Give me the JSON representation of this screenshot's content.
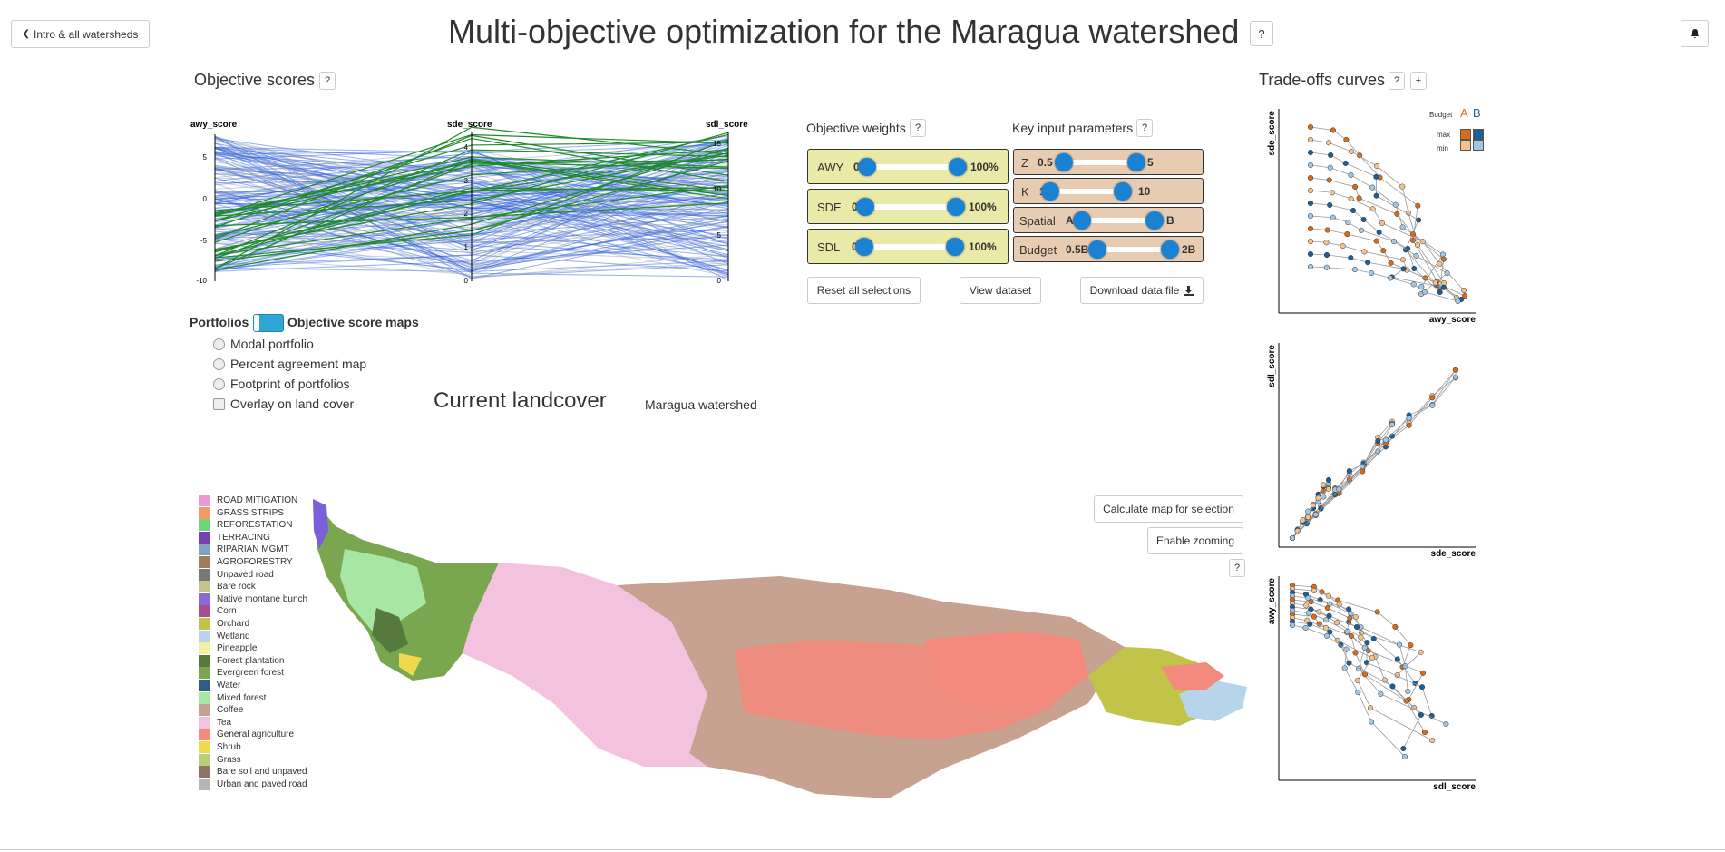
{
  "header": {
    "back_label": "Intro & all watersheds",
    "title": "Multi-objective optimization for the Maragua watershed",
    "help": "?",
    "notify_icon": "bell-icon"
  },
  "objective_scores": {
    "title": "Objective scores",
    "help": "?",
    "axes": [
      {
        "name": "awy_score",
        "ticks": [
          "5",
          "0",
          "-5",
          "-10"
        ]
      },
      {
        "name": "sde_score",
        "ticks": [
          "4",
          "3",
          "2",
          "1",
          "0"
        ]
      },
      {
        "name": "sdl_score",
        "ticks": [
          "15",
          "10",
          "5",
          "0"
        ]
      }
    ]
  },
  "toggle": {
    "left_label": "Portfolios",
    "right_label": "Objective score maps"
  },
  "map_options": {
    "modal": "Modal portfolio",
    "percent": "Percent agreement map",
    "footprint": "Footprint of portfolios",
    "overlay": "Overlay on land cover"
  },
  "map": {
    "title": "Current landcover",
    "watershed_name": "Maragua watershed",
    "calc_button": "Calculate map for selection",
    "zoom_button": "Enable zooming",
    "help": "?"
  },
  "legend": [
    {
      "label": "ROAD MITIGATION",
      "color": "#e99ad3"
    },
    {
      "label": "GRASS STRIPS",
      "color": "#f39a63"
    },
    {
      "label": "REFORESTATION",
      "color": "#6bd67b"
    },
    {
      "label": "TERRACING",
      "color": "#7a3fb0"
    },
    {
      "label": "RIPARIAN MGMT",
      "color": "#7fa3c4"
    },
    {
      "label": "AGROFORESTRY",
      "color": "#a07e5c"
    },
    {
      "label": "Unpaved road",
      "color": "#777777"
    },
    {
      "label": "Bare rock",
      "color": "#c3c38a"
    },
    {
      "label": "Native montane bunch",
      "color": "#8a6ad9"
    },
    {
      "label": "Corn",
      "color": "#a5508a"
    },
    {
      "label": "Orchard",
      "color": "#c2c44a"
    },
    {
      "label": "Wetland",
      "color": "#b6d5ea"
    },
    {
      "label": "Pineapple",
      "color": "#f4f0a2"
    },
    {
      "label": "Forest plantation",
      "color": "#567a3e"
    },
    {
      "label": "Evergreen forest",
      "color": "#7aa64f"
    },
    {
      "label": "Water",
      "color": "#2f5d86"
    },
    {
      "label": "Mixed forest",
      "color": "#a8e6a6"
    },
    {
      "label": "Coffee",
      "color": "#c7a291"
    },
    {
      "label": "Tea",
      "color": "#f3c2de"
    },
    {
      "label": "General agriculture",
      "color": "#f48a7b"
    },
    {
      "label": "Shrub",
      "color": "#f0d94a"
    },
    {
      "label": "Grass",
      "color": "#b5cf7d"
    },
    {
      "label": "Bare soil and unpaved",
      "color": "#8f7364"
    },
    {
      "label": "Urban and paved road",
      "color": "#b5b5b5"
    }
  ],
  "weights": {
    "title": "Objective weights",
    "help": "?",
    "items": [
      {
        "label": "AWY",
        "min": "0",
        "max": "100%"
      },
      {
        "label": "SDE",
        "min": "0",
        "max": "100%"
      },
      {
        "label": "SDL",
        "min": "0",
        "max": "100%"
      }
    ]
  },
  "params": {
    "title": "Key input parameters",
    "help": "?",
    "items": [
      {
        "label": "Z",
        "min": "0.5",
        "max": "5"
      },
      {
        "label": "K",
        "min": "1",
        "max": "10"
      },
      {
        "label": "Spatial",
        "min": "A",
        "max": "B"
      },
      {
        "label": "Budget",
        "min": "0.5B",
        "max": "2B"
      }
    ]
  },
  "actions": {
    "reset": "Reset all selections",
    "view": "View dataset",
    "download": "Download data file"
  },
  "tradeoffs": {
    "title": "Trade-offs curves",
    "help": "?",
    "add": "+",
    "legend": {
      "budget": "Budget",
      "a": "A",
      "b": "B",
      "max": "max",
      "min": "min"
    },
    "plots": [
      {
        "x": "awy_score",
        "y": "sde_score"
      },
      {
        "x": "sde_score",
        "y": "sdl_score"
      },
      {
        "x": "sdl_score",
        "y": "awy_score"
      }
    ],
    "colors": {
      "a_dark": "#d86a1a",
      "a_light": "#f2c28d",
      "b_dark": "#1c5f96",
      "b_light": "#9fc6e5"
    }
  }
}
